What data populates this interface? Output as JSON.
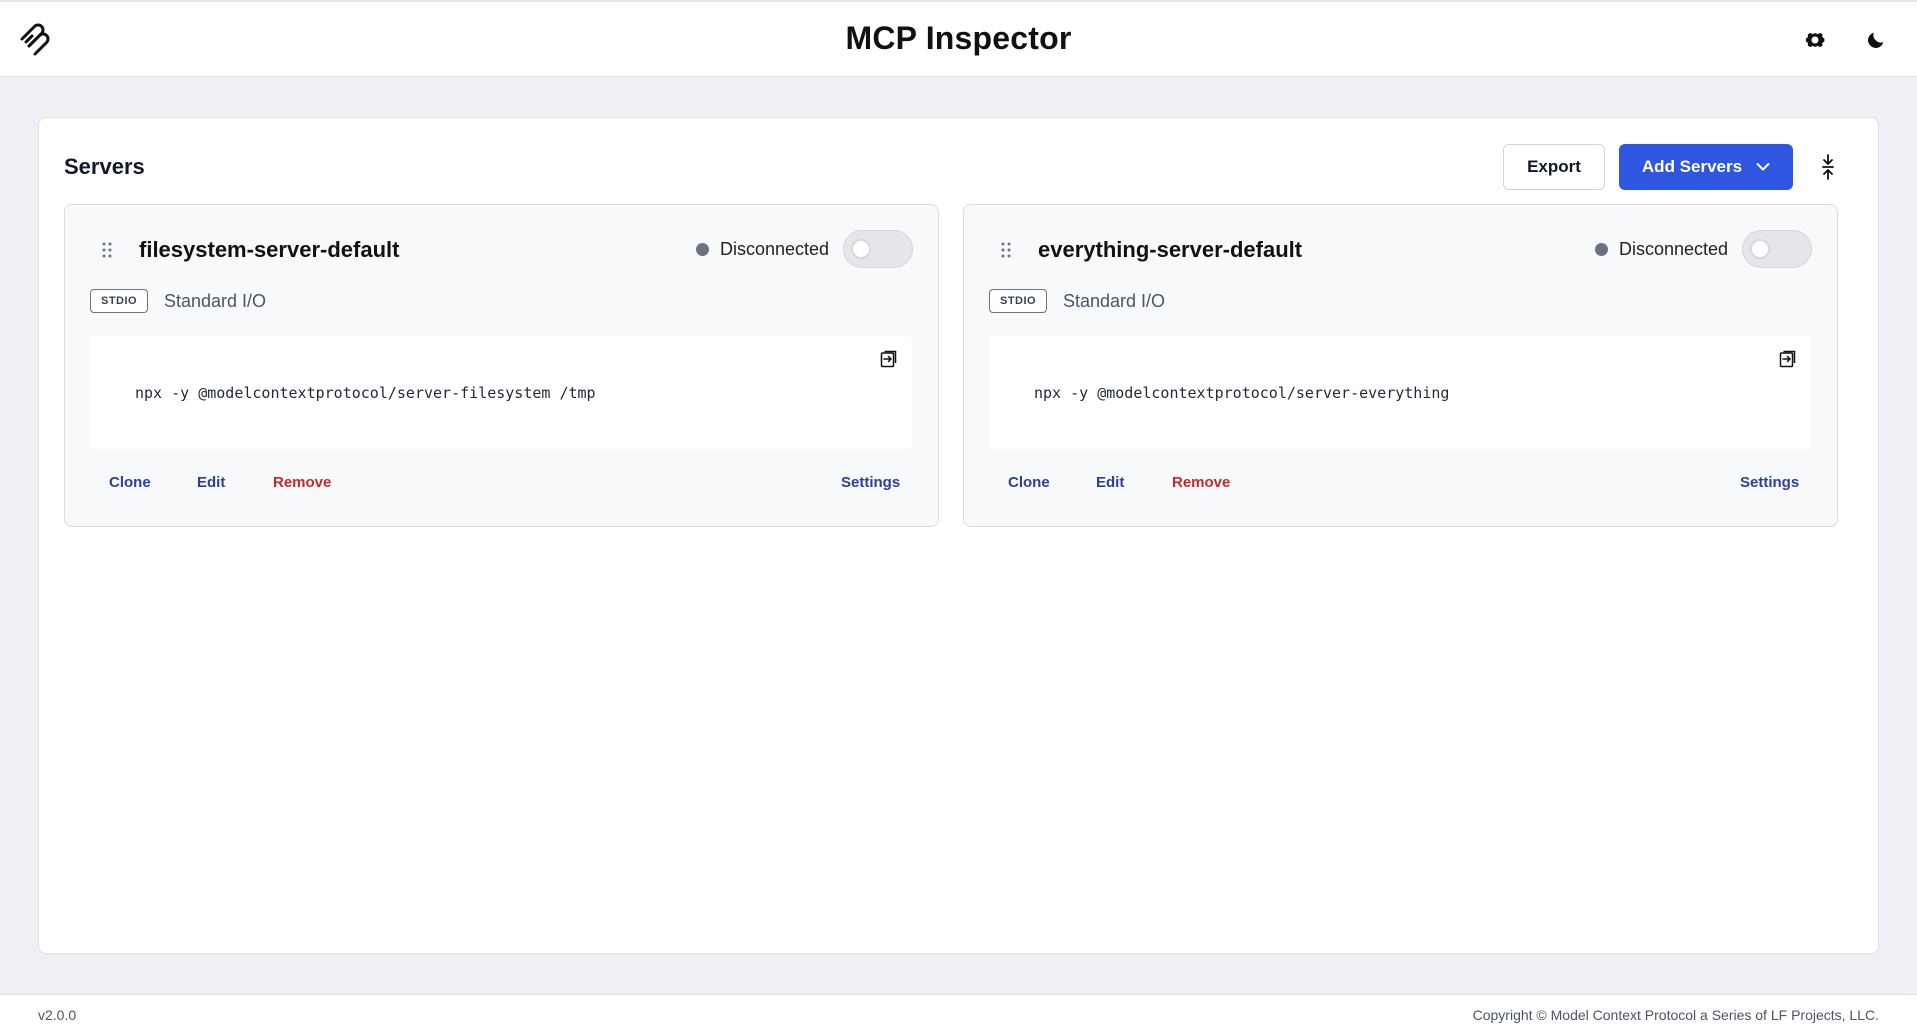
{
  "header": {
    "title": "MCP Inspector",
    "logo_icon": "mcp-logo-icon",
    "settings_icon": "gear-icon",
    "theme_icon": "moon-icon"
  },
  "servers_panel": {
    "title": "Servers",
    "export_label": "Export",
    "add_servers_label": "Add Servers",
    "collapse_icon": "collapse-vertical-icon"
  },
  "servers": [
    {
      "name": "filesystem-server-default",
      "status": "Disconnected",
      "status_color": "#6b7280",
      "connected": false,
      "transport_badge": "STDIO",
      "transport_label": "Standard I/O",
      "command": "npx -y @modelcontextprotocol/server-filesystem /tmp",
      "actions": {
        "clone": "Clone",
        "edit": "Edit",
        "remove": "Remove",
        "settings": "Settings"
      }
    },
    {
      "name": "everything-server-default",
      "status": "Disconnected",
      "status_color": "#6b7280",
      "connected": false,
      "transport_badge": "STDIO",
      "transport_label": "Standard I/O",
      "command": "npx -y @modelcontextprotocol/server-everything",
      "actions": {
        "clone": "Clone",
        "edit": "Edit",
        "remove": "Remove",
        "settings": "Settings"
      }
    }
  ],
  "footer": {
    "version": "v2.0.0",
    "copyright": "Copyright © Model Context Protocol a Series of LF Projects, LLC."
  },
  "colors": {
    "accent": "#2f56e0",
    "link": "#2d3f9a",
    "danger": "#c62828",
    "background": "#eef0f3"
  }
}
